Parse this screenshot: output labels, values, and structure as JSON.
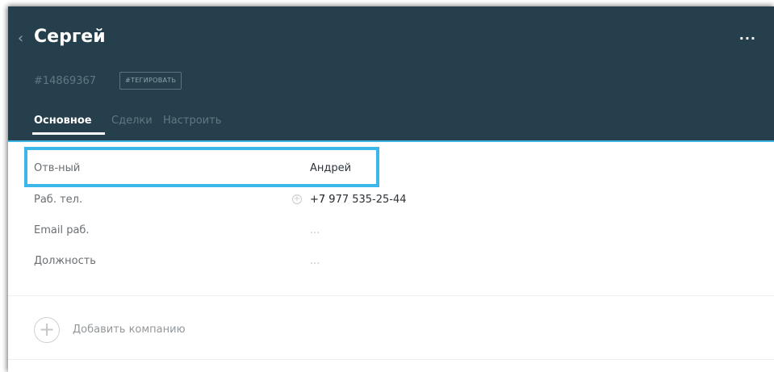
{
  "header": {
    "back_glyph": "‹",
    "title": "Сергей",
    "more_glyph": "...",
    "lead_id": "#14869367",
    "tag_button": "#ТЕГИРОВАТЬ",
    "tabs": [
      {
        "label": "Основное",
        "active": true
      },
      {
        "label": "Сделки",
        "active": false
      },
      {
        "label": "Настроить",
        "active": false
      }
    ]
  },
  "fields": [
    {
      "label": "Отв-ный",
      "value": "Андрей"
    },
    {
      "label": "Раб. тел.",
      "value": "+7 977 535-25-44"
    },
    {
      "label": "Email раб.",
      "value": "..."
    },
    {
      "label": "Должность",
      "value": "..."
    }
  ],
  "add_company": {
    "icon": "+",
    "label": "Добавить компанию"
  },
  "colors": {
    "header_bg": "#263f4c",
    "accent": "#3db4e4",
    "highlight": "#3bb7ea"
  }
}
